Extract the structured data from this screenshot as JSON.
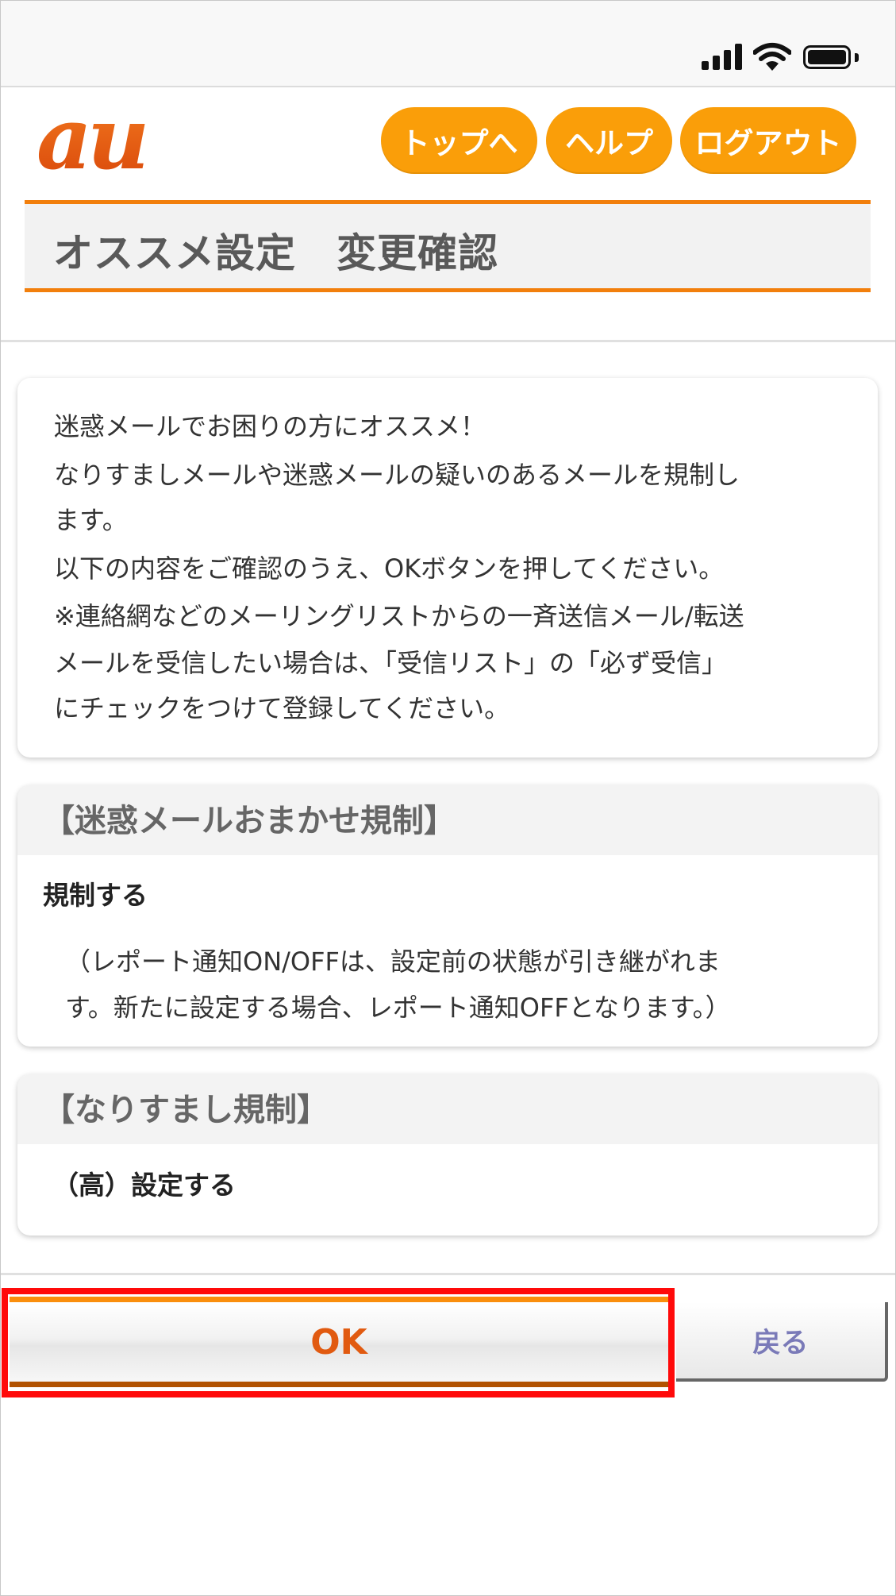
{
  "status_bar": {
    "icons": [
      "signal-icon",
      "wifi-icon",
      "battery-icon"
    ]
  },
  "header": {
    "logo_text": "au",
    "nav": {
      "top": "トップへ",
      "help": "ヘルプ",
      "logout": "ログアウト"
    },
    "page_title": "オススメ設定　変更確認"
  },
  "intro": {
    "lines": [
      "迷惑メールでお困りの方にオススメ！",
      "なりすましメールや迷惑メールの疑いのあるメールを規制し",
      "ます。",
      "以下の内容をご確認のうえ、OKボタンを押してください。",
      "※連絡網などのメーリングリストからの一斉送信メール/転送",
      "メールを受信したい場合は、「受信リスト」の「必ず受信」",
      "にチェックをつけて登録してください。"
    ]
  },
  "section_spam": {
    "heading": "【迷惑メールおまかせ規制】",
    "value": "規制する",
    "note_lines": [
      "（レポート通知ON/OFFは、設定前の状態が引き継がれま",
      "す。新たに設定する場合、レポート通知OFFとなります。）"
    ]
  },
  "section_spoof": {
    "heading": "【なりすまし規制】",
    "value": "（高）設定する"
  },
  "actions": {
    "ok": "OK",
    "back": "戻る"
  },
  "colors": {
    "accent_orange": "#fa9e09",
    "title_border": "#f27f0c",
    "ok_text": "#e15a10",
    "highlight": "#ff0a0a",
    "back_text": "#7a7ab8"
  }
}
